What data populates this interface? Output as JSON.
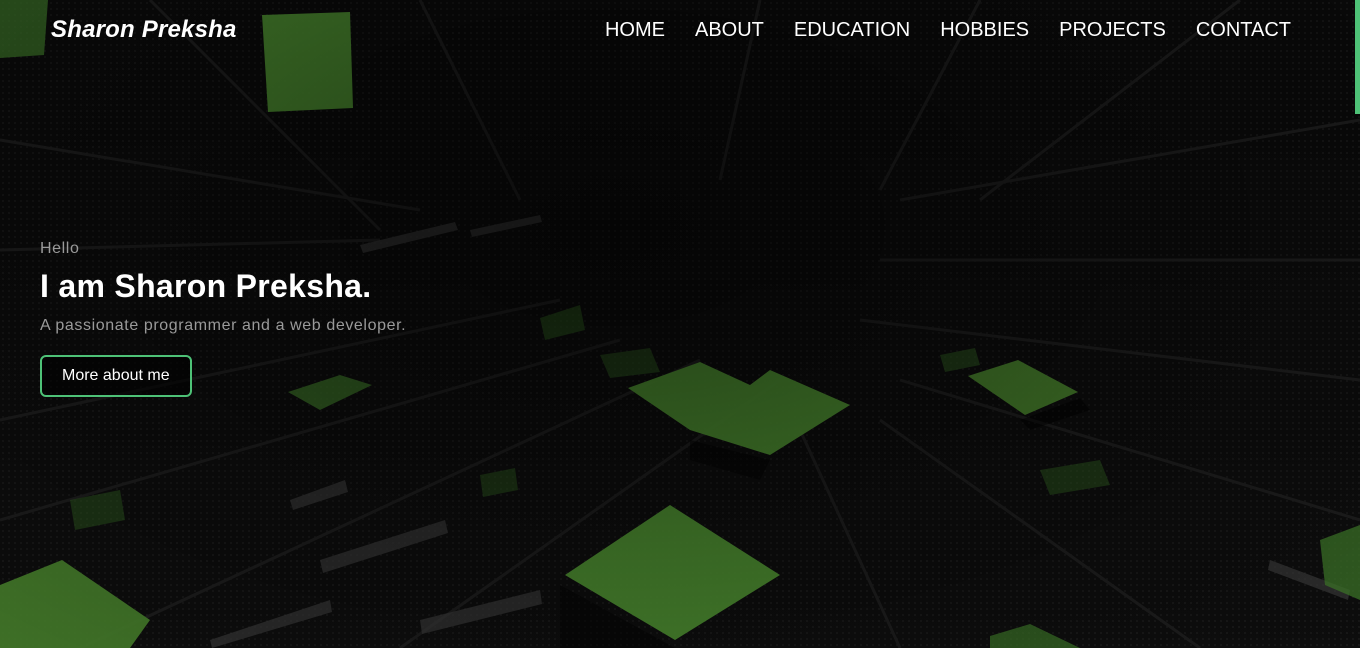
{
  "brand": {
    "name": "Sharon Preksha"
  },
  "nav": {
    "items": [
      {
        "label": "HOME"
      },
      {
        "label": "ABOUT"
      },
      {
        "label": "EDUCATION"
      },
      {
        "label": "HOBBIES"
      },
      {
        "label": "PROJECTS"
      },
      {
        "label": "CONTACT"
      }
    ]
  },
  "hero": {
    "greeting": "Hello",
    "title": "I am Sharon Preksha.",
    "subtitle": "A passionate programmer and a web developer.",
    "button_label": "More about me"
  },
  "colors": {
    "accent": "#4ec277",
    "tile_green": "#4e8f32",
    "background": "#070707",
    "text_primary": "#ffffff",
    "text_muted": "#9a9a9a"
  }
}
